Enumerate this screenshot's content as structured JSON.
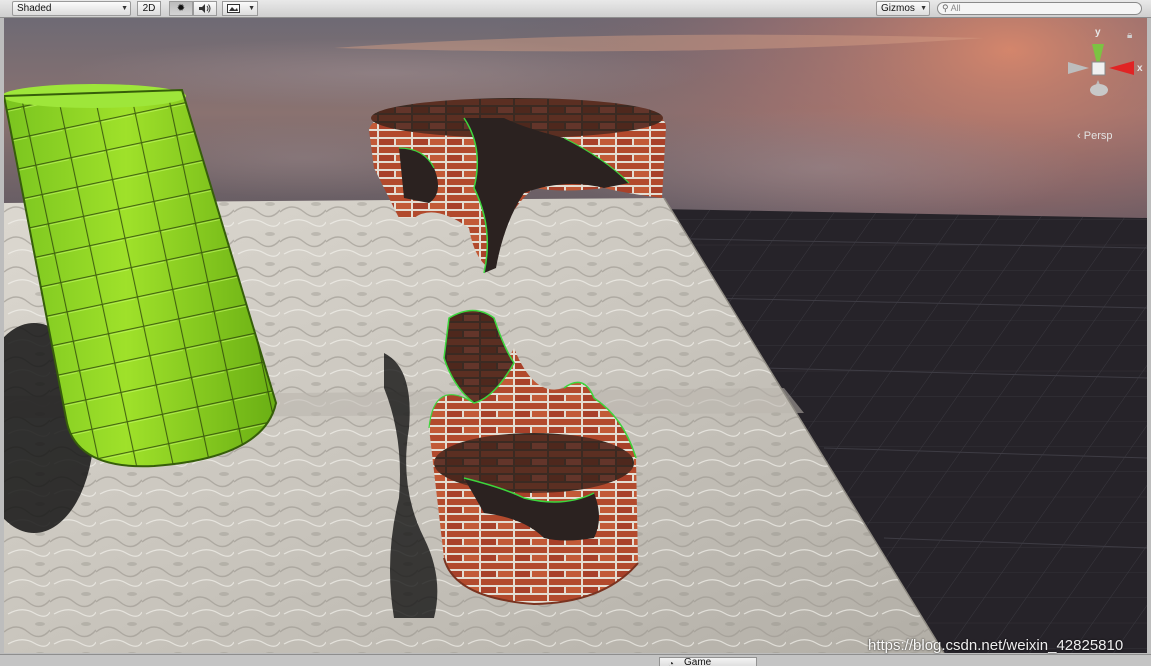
{
  "toolbar": {
    "shading_mode": "Shaded",
    "mode_2d": "2D",
    "light_icon": "sun-icon",
    "audio_icon": "speaker-icon",
    "effects_icon": "image-icon",
    "gizmos_label": "Gizmos",
    "search_placeholder": "All",
    "search_icon": "search-icon"
  },
  "scene": {
    "projection_label": "Persp",
    "orientation_gizmo": {
      "y_label": "y",
      "x_label": "x",
      "colors": {
        "y": "#7cc242",
        "x": "#e02424",
        "z": "#3c6fd6"
      }
    },
    "watermark": "https://blog.csdn.net/weixin_42825810"
  },
  "bottom": {
    "game_tab_label": "Game",
    "game_icon": "pacman-icon"
  }
}
